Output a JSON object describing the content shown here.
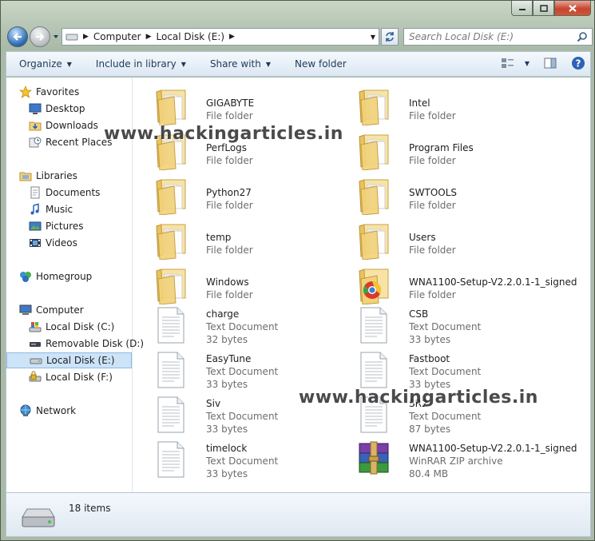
{
  "address": {
    "segments": [
      "Computer",
      "Local Disk (E:)"
    ],
    "search_placeholder": "Search Local Disk (E:)"
  },
  "toolbar": {
    "organize": "Organize",
    "include_in_library": "Include in library",
    "share_with": "Share with",
    "new_folder": "New folder"
  },
  "nav": {
    "favorites": "Favorites",
    "desktop": "Desktop",
    "downloads": "Downloads",
    "recent": "Recent Places",
    "libraries": "Libraries",
    "documents": "Documents",
    "music": "Music",
    "pictures": "Pictures",
    "videos": "Videos",
    "homegroup": "Homegroup",
    "computer": "Computer",
    "disk_c": "Local Disk (C:)",
    "removable_d": "Removable Disk (D:)",
    "disk_e": "Local Disk (E:)",
    "disk_f": "Local Disk (F:)",
    "network": "Network"
  },
  "files": [
    {
      "name": "GIGABYTE",
      "type": "File folder",
      "size": ""
    },
    {
      "name": "Intel",
      "type": "File folder",
      "size": ""
    },
    {
      "name": "PerfLogs",
      "type": "File folder",
      "size": ""
    },
    {
      "name": "Program Files",
      "type": "File folder",
      "size": ""
    },
    {
      "name": "Python27",
      "type": "File folder",
      "size": ""
    },
    {
      "name": "SWTOOLS",
      "type": "File folder",
      "size": ""
    },
    {
      "name": "temp",
      "type": "File folder",
      "size": ""
    },
    {
      "name": "Users",
      "type": "File folder",
      "size": ""
    },
    {
      "name": "Windows",
      "type": "File folder",
      "size": ""
    },
    {
      "name": "WNA1100-Setup-V2.2.0.1-1_signed",
      "type": "File folder",
      "size": ""
    },
    {
      "name": "charge",
      "type": "Text Document",
      "size": "32 bytes"
    },
    {
      "name": "CSB",
      "type": "Text Document",
      "size": "33 bytes"
    },
    {
      "name": "EasyTune",
      "type": "Text Document",
      "size": "33 bytes"
    },
    {
      "name": "Fastboot",
      "type": "Text Document",
      "size": "33 bytes"
    },
    {
      "name": "Siv",
      "type": "Text Document",
      "size": "33 bytes"
    },
    {
      "name": "SR2",
      "type": "Text Document",
      "size": "87 bytes"
    },
    {
      "name": "timelock",
      "type": "Text Document",
      "size": "33 bytes"
    },
    {
      "name": "WNA1100-Setup-V2.2.0.1-1_signed",
      "type": "WinRAR ZIP archive",
      "size": "80.4 MB"
    }
  ],
  "watermark": "www.hackingarticles.in",
  "status": {
    "item_count": "18 items"
  },
  "colors": {
    "selection": "#cde3f7",
    "folder": "#f2d27a",
    "accent": "#1e395b"
  }
}
